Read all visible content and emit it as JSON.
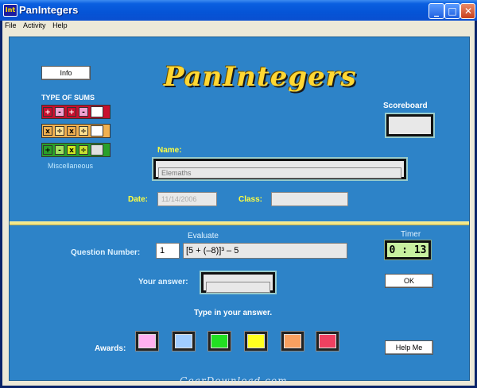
{
  "window": {
    "title": "PanIntegers",
    "app_icon": "Int"
  },
  "menu": [
    "File",
    "Activity",
    "Help"
  ],
  "logo": "PanIntegers",
  "info_button": "Info",
  "type_of_sums": {
    "heading": "TYPE OF SUMS",
    "rows": [
      {
        "color": "#c8102e",
        "ops": [
          "+",
          "-",
          "+",
          "-"
        ]
      },
      {
        "color": "#f0b050",
        "ops": [
          "x",
          "÷",
          "x",
          "÷"
        ]
      },
      {
        "color": "#2aa02a",
        "ops": [
          "+",
          "-",
          "x",
          "÷"
        ]
      }
    ],
    "caption": "Miscellaneous"
  },
  "scoreboard": {
    "label": "Scoreboard",
    "value": ""
  },
  "name": {
    "label": "Name:",
    "placeholder": "Elemaths"
  },
  "date": {
    "label": "Date:",
    "value": "11/14/2006"
  },
  "class": {
    "label": "Class:",
    "value": ""
  },
  "question": {
    "label": "Question Number:",
    "number": "1",
    "evaluate_label": "Evaluate",
    "expression": "[5 + (–8)]³ – 5"
  },
  "timer": {
    "label": "Timer",
    "value": "0 : 13"
  },
  "answer": {
    "label": "Your answer:",
    "value": ""
  },
  "ok_button": "OK",
  "instruction": "Type in your answer.",
  "awards": {
    "label": "Awards:",
    "colors": [
      "#ffb0f0",
      "#a0ccff",
      "#22e022",
      "#ffff20",
      "#f8a060",
      "#f04060"
    ]
  },
  "help_button": "Help Me",
  "watermark": "GearDownload.com"
}
